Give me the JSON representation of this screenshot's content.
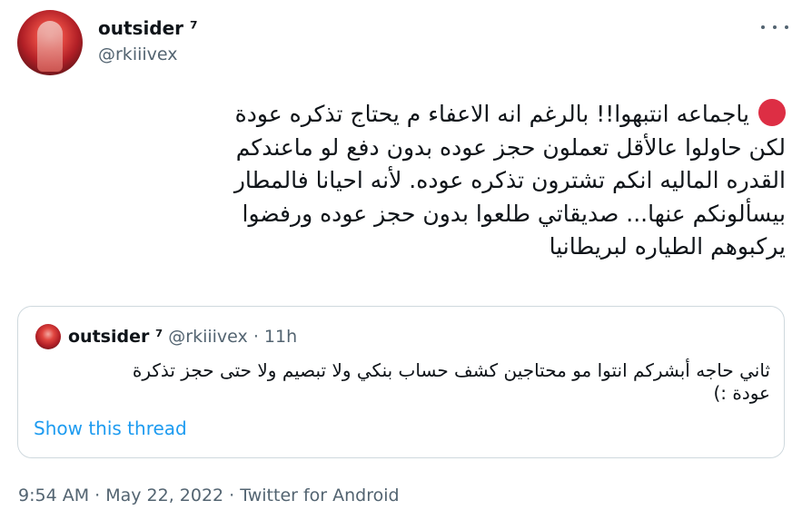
{
  "author": {
    "display_name": "outsider ⁷",
    "handle": "@rkiiivex"
  },
  "tweet": {
    "lines": [
      "ياجماعه انتبهوا!! بالرغم انه الاعفاء م يحتاج تذكره عودة",
      "لكن حاولوا عالأقل تعملون حجز عوده بدون دفع لو ماعندكم",
      "القدره الماليه انكم تشترون تذكره عوده. لأنه احيانا فالمطار",
      "بيسألونكم عنها... صديقاتي طلعوا بدون حجز عوده ورفضوا",
      "يركبوهم الطياره لبريطانيا"
    ],
    "emoji": "red-circle",
    "emoji_color": "#dd2e44"
  },
  "quoted_tweet": {
    "display_name": "outsider ⁷",
    "meta": "@rkiiivex · 11h",
    "lines": [
      "ثاني حاجه أبشركم انتوا مو محتاجين كشف حساب بنكي ولا تبصيم ولا حتى حجز تذكرة",
      "عودة :)"
    ],
    "show_thread": "Show this thread"
  },
  "footer": {
    "timestamp": "9:54 AM · May 22, 2022 · Twitter for Android"
  },
  "colors": {
    "link": "#1d9bf0",
    "secondary_text": "#536471",
    "border": "#cfd9de"
  }
}
